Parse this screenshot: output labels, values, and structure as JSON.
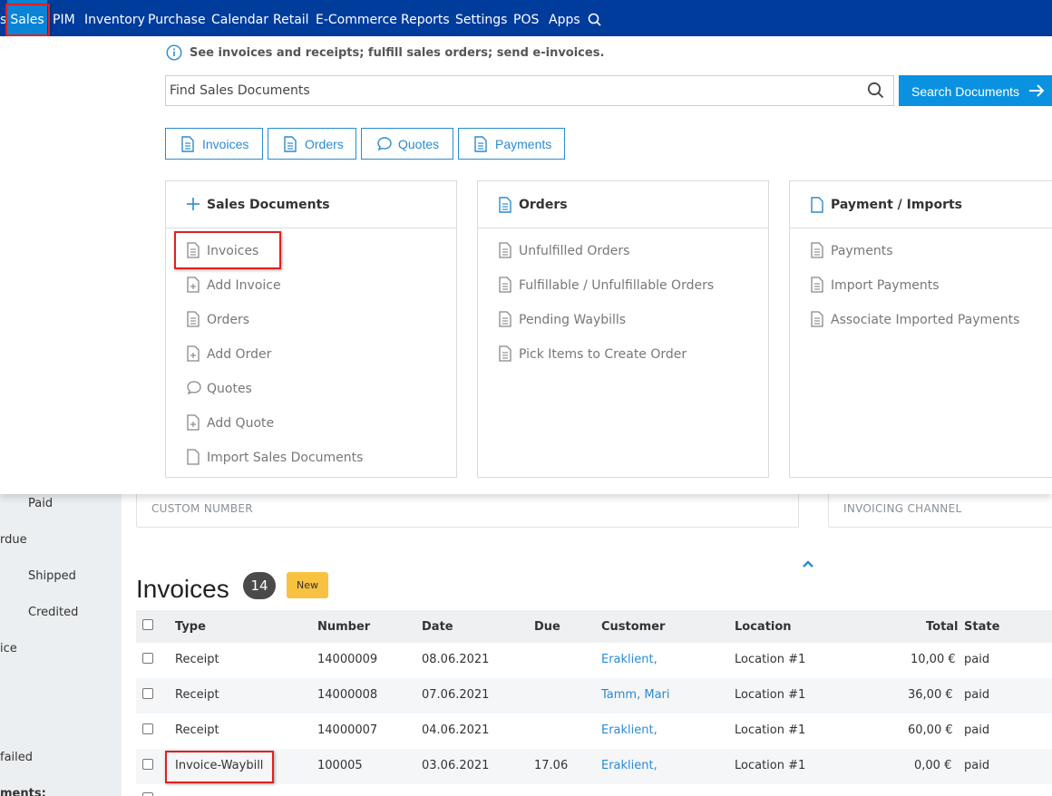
{
  "nav": {
    "items": [
      "s",
      "Sales",
      "PIM",
      "Inventory",
      "Purchase",
      "Calendar",
      "Retail",
      "E-Commerce",
      "Reports",
      "Settings",
      "POS",
      "Apps"
    ]
  },
  "sidebar": {
    "items": [
      "Paid",
      "rdue",
      "Shipped",
      "Credited",
      "ice",
      "failed",
      "ments:"
    ]
  },
  "filters": {
    "custom_number": "CUSTOM NUMBER",
    "invoicing_channel": "INVOICING CHANNEL"
  },
  "invoices": {
    "title": "Invoices",
    "count": "14",
    "new_label": "New",
    "columns": [
      "Type",
      "Number",
      "Date",
      "Due",
      "Customer",
      "Location",
      "Total",
      "State"
    ],
    "rows": [
      {
        "type": "Receipt",
        "number": "14000009",
        "date": "08.06.2021",
        "due": "",
        "customer": "Eraklient,",
        "location": "Location #1",
        "total": "10,00 €",
        "state": "paid"
      },
      {
        "type": "Receipt",
        "number": "14000008",
        "date": "07.06.2021",
        "due": "",
        "customer": "Tamm, Mari",
        "location": "Location #1",
        "total": "36,00 €",
        "state": "paid"
      },
      {
        "type": "Receipt",
        "number": "14000007",
        "date": "04.06.2021",
        "due": "",
        "customer": "Eraklient,",
        "location": "Location #1",
        "total": "60,00 €",
        "state": "paid"
      },
      {
        "type": "Invoice-Waybill",
        "number": "100005",
        "date": "03.06.2021",
        "due": "17.06",
        "customer": "Eraklient,",
        "location": "Location #1",
        "total": "0,00 €",
        "state": "paid"
      }
    ]
  },
  "panel": {
    "info": "See invoices and receipts; fulfill sales orders; send e-invoices.",
    "search_placeholder": "Find Sales Documents",
    "search_button": "Search Documents",
    "quick_buttons": [
      "Invoices",
      "Orders",
      "Quotes",
      "Payments"
    ],
    "columns": [
      {
        "title": "Sales Documents",
        "items": [
          "Invoices",
          "Add Invoice",
          "Orders",
          "Add Order",
          "Quotes",
          "Add Quote",
          "Import Sales Documents"
        ]
      },
      {
        "title": "Orders",
        "items": [
          "Unfulfilled Orders",
          "Fulfillable / Unfulfillable Orders",
          "Pending Waybills",
          "Pick Items to Create Order"
        ]
      },
      {
        "title": "Payment / Imports",
        "items": [
          "Payments",
          "Import Payments",
          "Associate Imported Payments"
        ]
      }
    ]
  },
  "colors": {
    "nav_bg": "#003c9c",
    "nav_active": "#0a84d6",
    "accent": "#0a92e0",
    "link": "#2a8ccf",
    "badge_new": "#f7c240",
    "highlight": "#e02020"
  }
}
